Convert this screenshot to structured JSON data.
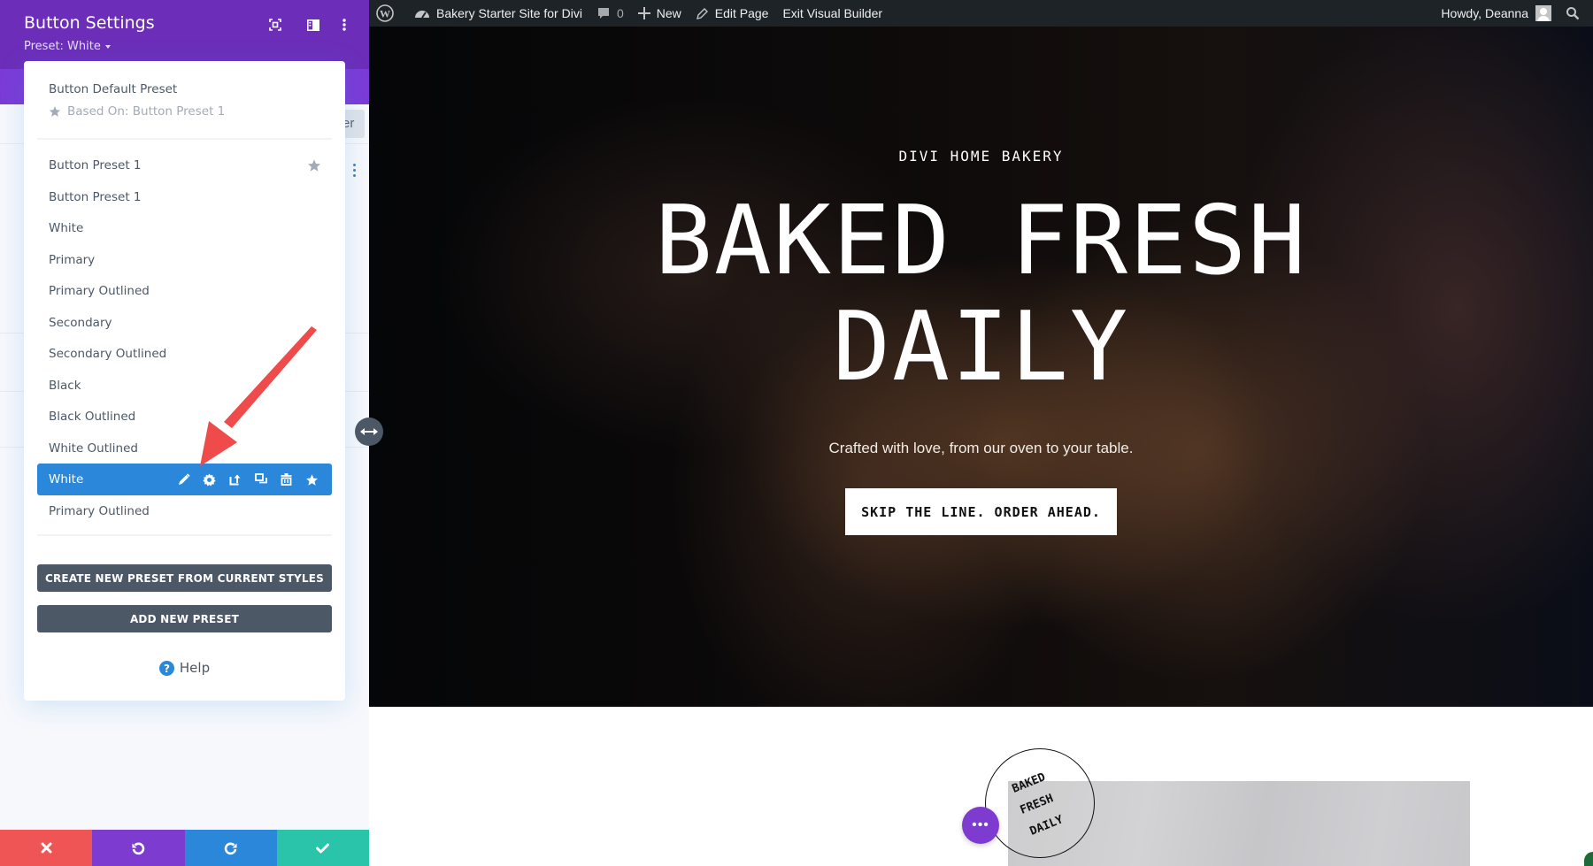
{
  "sidebar": {
    "title": "Button Settings",
    "preset_label": "Preset: White",
    "header_icons": [
      "focus-mode-icon",
      "split-view-icon",
      "more-options-icon"
    ],
    "behind_filter_text": "er",
    "footer": {
      "discard": "close-icon",
      "undo": "undo-icon",
      "redo": "redo-icon",
      "save": "check-icon",
      "colors": {
        "discard": "#ef5555",
        "undo": "#7e3bd0",
        "redo": "#2b87da",
        "save": "#29c4a9"
      }
    }
  },
  "preset_menu": {
    "default_preset": {
      "title": "Button Default Preset",
      "based_on": "Based On: Button Preset 1"
    },
    "items": [
      {
        "label": "Button Preset 1",
        "starred": true
      },
      {
        "label": "Button Preset 1"
      },
      {
        "label": "White"
      },
      {
        "label": "Primary"
      },
      {
        "label": "Primary Outlined"
      },
      {
        "label": "Secondary"
      },
      {
        "label": "Secondary Outlined"
      },
      {
        "label": "Black"
      },
      {
        "label": "Black Outlined"
      },
      {
        "label": "White Outlined"
      },
      {
        "label": "White",
        "selected": true,
        "actions": [
          "edit-icon",
          "settings-icon",
          "export-icon",
          "duplicate-icon",
          "delete-icon",
          "star-icon"
        ]
      },
      {
        "label": "Primary Outlined"
      }
    ],
    "create_button": "CREATE NEW PRESET FROM CURRENT STYLES",
    "add_button": "ADD NEW PRESET",
    "help": "Help",
    "accent": "#2b87da"
  },
  "adminbar": {
    "site_name": "Bakery Starter Site for Divi",
    "comments_count": "0",
    "new_label": "New",
    "edit_label": "Edit Page",
    "exit_label": "Exit Visual Builder",
    "greeting": "Howdy, Deanna"
  },
  "hero": {
    "kicker": "DIVI HOME BAKERY",
    "title_line1": "BAKED FRESH",
    "title_line2": "DAILY",
    "subtitle": "Crafted with love, from our oven to your table.",
    "cta": "SKIP THE LINE. ORDER AHEAD."
  },
  "section2": {
    "stamp_lines": [
      "BAKED",
      "FRESH",
      "DAILY"
    ],
    "more_button": "•••"
  },
  "colors": {
    "header_purple": "#6c2eb9",
    "tab_purple": "#7b3bd6",
    "button_gray": "#4c5866",
    "annotation_red": "#ef4b4b"
  }
}
